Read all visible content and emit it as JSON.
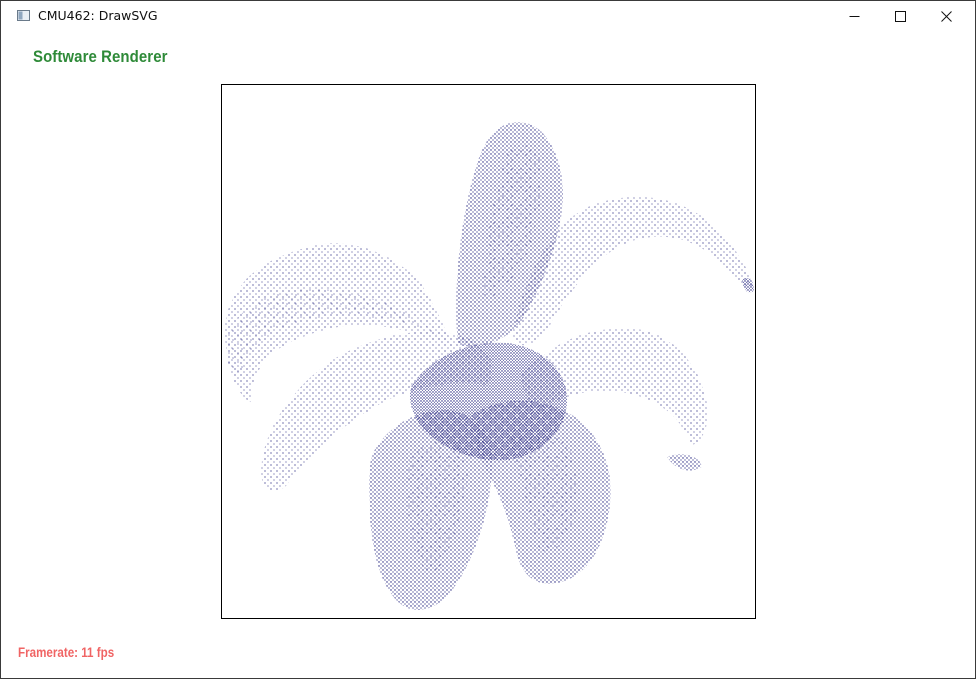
{
  "window": {
    "title": "CMU462: DrawSVG",
    "controls": {
      "minimize": "minimize",
      "maximize": "maximize",
      "close": "close"
    }
  },
  "renderer": {
    "label": "Software Renderer",
    "label_color": "#2e8a38"
  },
  "canvas": {
    "background": "#ffffff",
    "border_color": "#000000",
    "stipple_color": "#1b1b7a",
    "subject": "stippled lily flower"
  },
  "status": {
    "framerate_text": "Framerate: 11 fps",
    "framerate_color": "#f06464"
  }
}
